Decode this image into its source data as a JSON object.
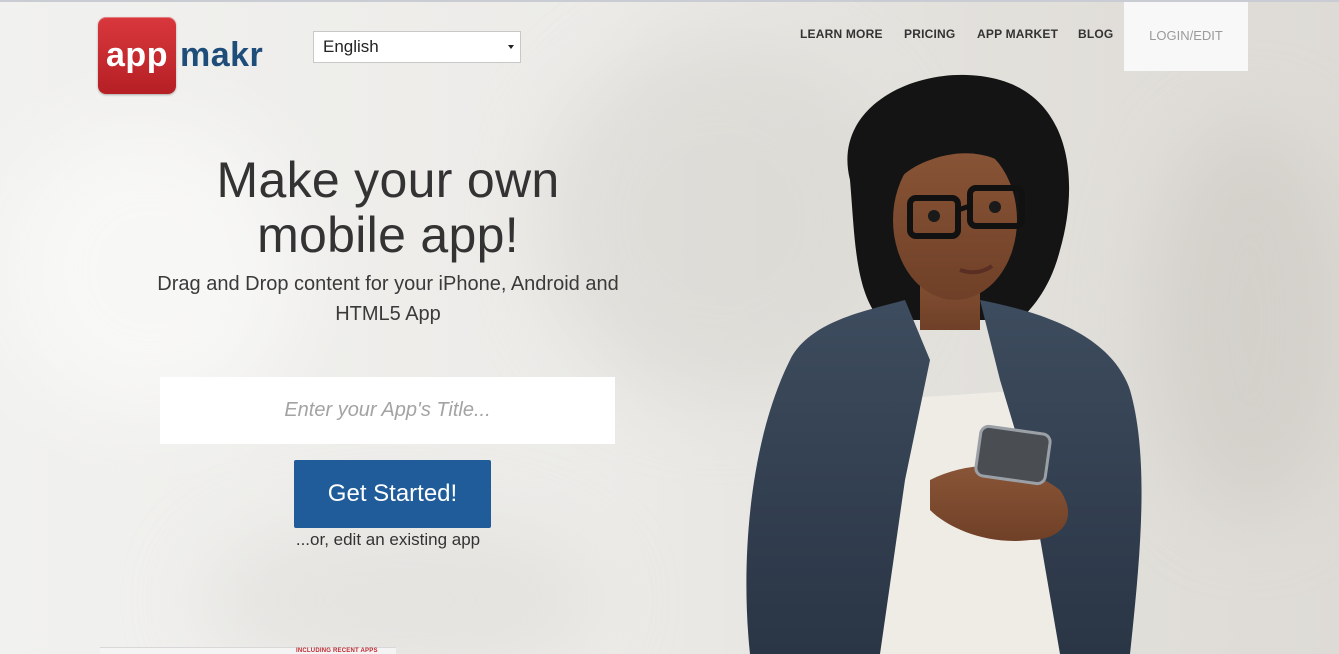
{
  "logo": {
    "app": "app",
    "makr": "makr",
    "brand_red": "#c4282d",
    "brand_blue": "#1e4d7a"
  },
  "language_select": {
    "selected": "English"
  },
  "nav": {
    "learn_more": "LEARN MORE",
    "pricing": "PRICING",
    "app_market": "APP MARKET",
    "blog": "BLOG",
    "login_edit": "LOGIN/EDIT"
  },
  "hero": {
    "headline_line1": "Make your own",
    "headline_line2": "mobile app!",
    "subhead_line1": "Drag and Drop content for your iPhone, Android and",
    "subhead_line2": "HTML5 App",
    "input_placeholder": "Enter your App's Title...",
    "cta_label": "Get Started!",
    "cta_color": "#1f5c99",
    "edit_existing": "...or, edit an existing app"
  },
  "bottom_strip": {
    "label": "INCLUDING RECENT APPS"
  }
}
